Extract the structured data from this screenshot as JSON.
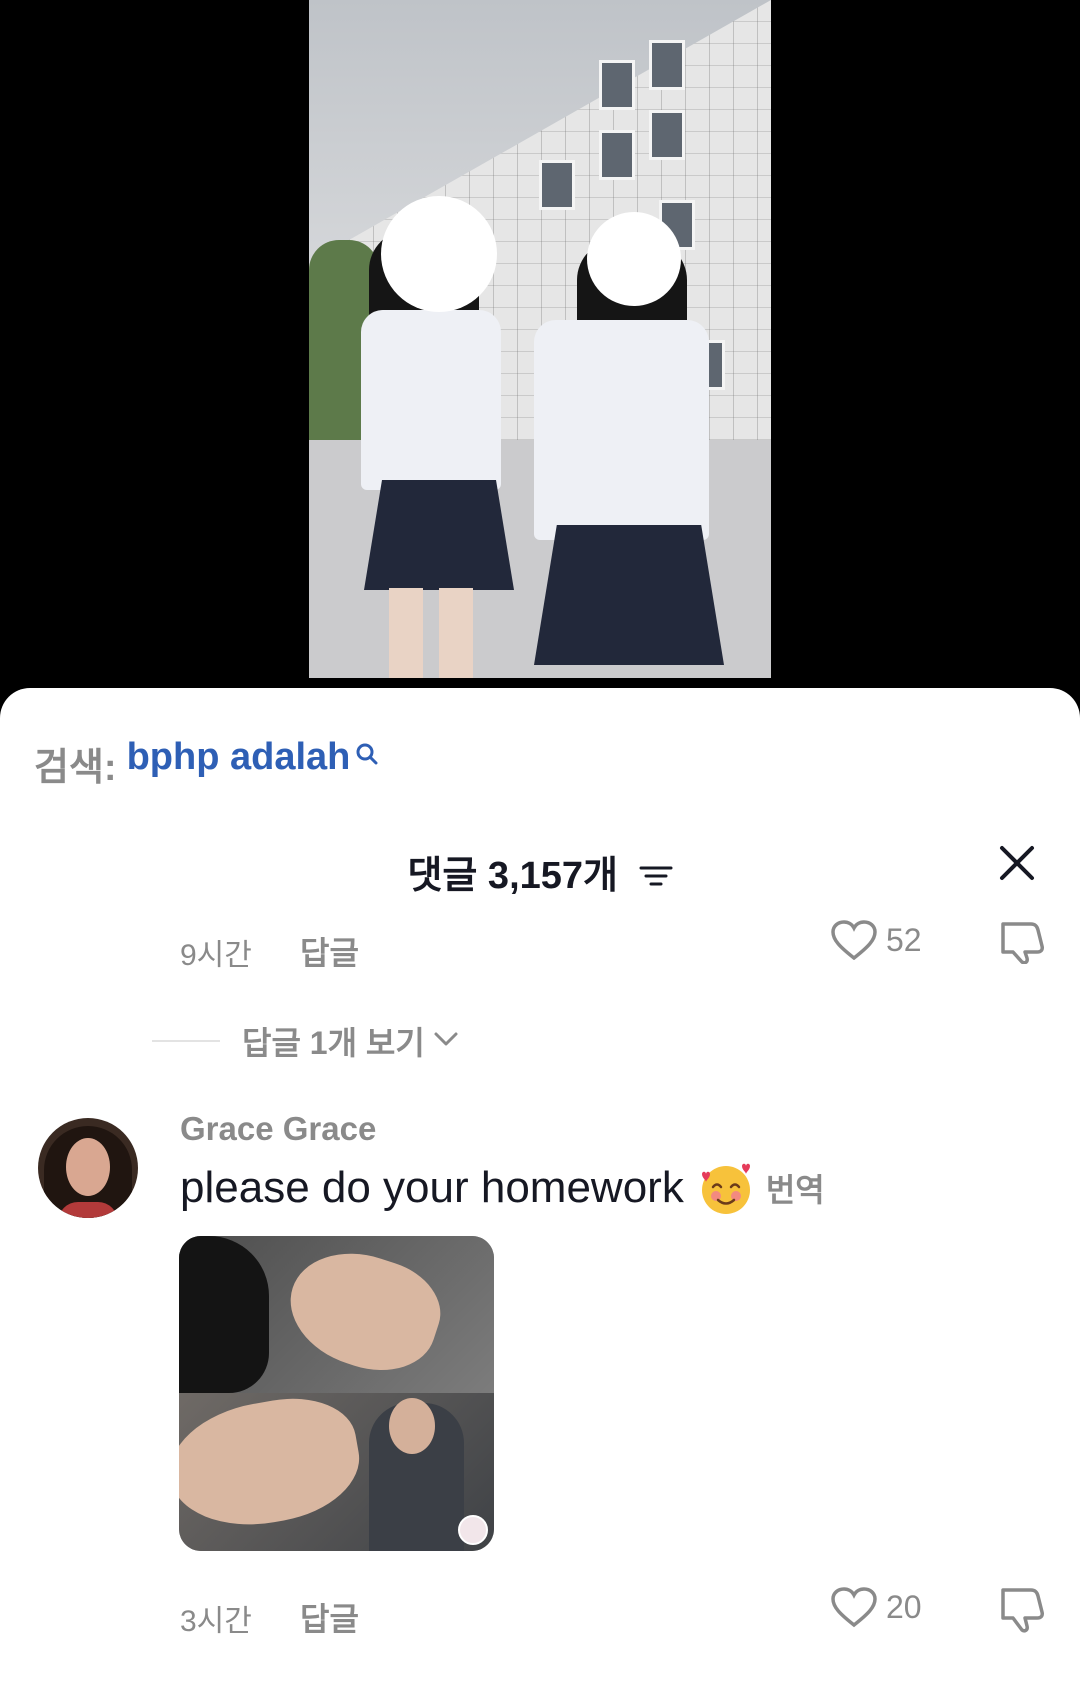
{
  "search": {
    "prefix": "검색:",
    "term": "bphp adalah"
  },
  "header": {
    "comments_count": "댓글 3,157개"
  },
  "previous_comment": {
    "time": "9시간",
    "reply_label": "답글",
    "likes": "52"
  },
  "view_replies": {
    "label": "답글 1개 보기"
  },
  "comment": {
    "username": "Grace Grace",
    "text": "please do your homework",
    "translate_label": "번역",
    "time": "3시간",
    "reply_label": "답글",
    "likes": "20"
  },
  "colors": {
    "link": "#2e5fb5",
    "muted": "#8a8a8a",
    "text": "#161823"
  }
}
